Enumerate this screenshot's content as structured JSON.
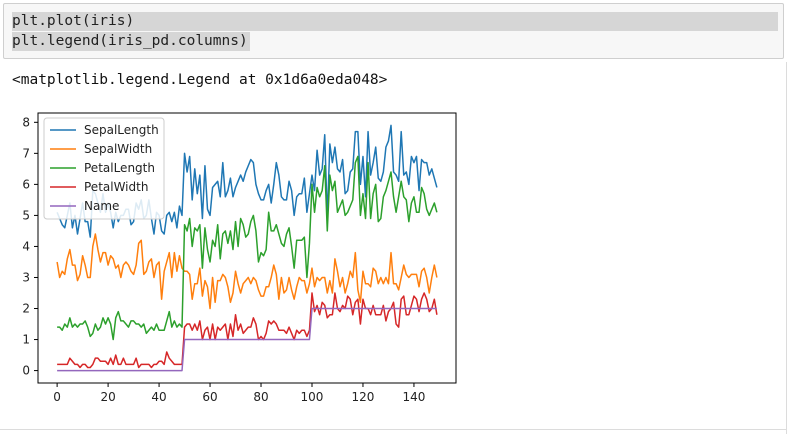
{
  "code_cell": {
    "lines": [
      "plt.plot(iris)",
      "plt.legend(iris_pd.columns)"
    ]
  },
  "output": {
    "text": "<matplotlib.legend.Legend at 0x1d6a0eda048>"
  },
  "chart_data": {
    "type": "line",
    "x_ticks": [
      0,
      20,
      40,
      60,
      80,
      100,
      120,
      140
    ],
    "y_ticks": [
      0,
      1,
      2,
      3,
      4,
      5,
      6,
      7,
      8
    ],
    "xlim": [
      -7.5,
      156.5
    ],
    "ylim": [
      -0.4,
      8.3
    ],
    "legend_position": "upper-left",
    "grid": false,
    "series": [
      {
        "name": "SepalLength",
        "color": "#1f77b4",
        "values": [
          5.1,
          4.9,
          4.7,
          4.6,
          5.0,
          5.4,
          4.6,
          5.0,
          4.4,
          4.9,
          5.4,
          4.8,
          4.8,
          4.3,
          5.8,
          5.7,
          5.4,
          5.1,
          5.7,
          5.1,
          5.4,
          5.1,
          4.6,
          5.1,
          4.8,
          5.0,
          5.0,
          5.2,
          5.2,
          4.7,
          4.8,
          5.4,
          5.2,
          5.5,
          4.9,
          5.0,
          5.5,
          4.9,
          4.4,
          5.1,
          5.0,
          4.5,
          4.4,
          5.0,
          5.1,
          4.8,
          5.1,
          4.6,
          5.3,
          5.0,
          7.0,
          6.4,
          6.9,
          5.5,
          6.5,
          5.7,
          6.3,
          4.9,
          6.6,
          5.2,
          5.0,
          5.9,
          6.0,
          6.1,
          5.6,
          6.7,
          5.6,
          5.8,
          6.2,
          5.6,
          5.9,
          6.1,
          6.3,
          6.1,
          6.4,
          6.6,
          6.8,
          6.7,
          6.0,
          5.7,
          5.5,
          5.5,
          5.8,
          6.0,
          5.4,
          6.0,
          6.7,
          6.3,
          5.6,
          5.5,
          5.5,
          6.1,
          5.8,
          5.0,
          5.6,
          5.7,
          5.7,
          6.2,
          5.1,
          5.7,
          6.3,
          5.8,
          7.1,
          6.3,
          6.5,
          7.6,
          4.9,
          7.3,
          6.7,
          7.2,
          6.5,
          6.4,
          6.8,
          5.7,
          5.8,
          6.4,
          6.5,
          7.7,
          7.7,
          6.0,
          6.9,
          5.6,
          7.7,
          6.3,
          6.7,
          7.2,
          6.2,
          6.1,
          6.4,
          7.2,
          7.4,
          7.9,
          6.4,
          6.3,
          6.1,
          7.7,
          6.3,
          6.4,
          6.0,
          6.9,
          6.7,
          6.9,
          5.8,
          6.8,
          6.7,
          6.7,
          6.3,
          6.5,
          6.2,
          5.9
        ]
      },
      {
        "name": "SepalWidth",
        "color": "#ff7f0e",
        "values": [
          3.5,
          3.0,
          3.2,
          3.1,
          3.6,
          3.9,
          3.4,
          3.4,
          2.9,
          3.1,
          3.7,
          3.4,
          3.0,
          3.0,
          4.0,
          4.4,
          3.9,
          3.5,
          3.8,
          3.8,
          3.4,
          3.7,
          3.6,
          3.3,
          3.4,
          3.0,
          3.4,
          3.5,
          3.4,
          3.2,
          3.1,
          3.4,
          4.1,
          4.2,
          3.1,
          3.2,
          3.5,
          3.6,
          3.0,
          3.4,
          3.5,
          2.3,
          3.2,
          3.5,
          3.8,
          3.0,
          3.8,
          3.2,
          3.7,
          3.3,
          3.2,
          3.2,
          3.1,
          2.3,
          2.8,
          2.8,
          3.3,
          2.4,
          2.9,
          2.7,
          2.0,
          3.0,
          2.2,
          2.9,
          2.9,
          3.1,
          3.0,
          2.7,
          2.2,
          2.5,
          3.2,
          2.8,
          2.5,
          2.8,
          2.9,
          3.0,
          2.8,
          3.0,
          2.9,
          2.6,
          2.4,
          2.4,
          2.7,
          2.7,
          3.0,
          3.4,
          3.1,
          2.3,
          3.0,
          2.5,
          2.6,
          3.0,
          2.6,
          2.3,
          2.7,
          3.0,
          2.9,
          2.9,
          2.5,
          2.8,
          3.3,
          2.7,
          3.0,
          2.9,
          3.0,
          3.0,
          2.5,
          2.9,
          2.5,
          3.6,
          3.2,
          2.7,
          3.0,
          2.5,
          2.8,
          3.2,
          3.0,
          3.8,
          2.6,
          2.2,
          3.2,
          2.8,
          2.8,
          2.7,
          3.3,
          3.2,
          2.8,
          3.0,
          2.8,
          3.0,
          2.8,
          3.8,
          2.8,
          2.8,
          2.6,
          3.0,
          3.4,
          3.1,
          3.0,
          3.1,
          3.1,
          3.1,
          2.7,
          3.2,
          3.3,
          3.0,
          2.5,
          3.0,
          3.4,
          3.0
        ]
      },
      {
        "name": "PetalLength",
        "color": "#2ca02c",
        "values": [
          1.4,
          1.4,
          1.3,
          1.5,
          1.4,
          1.7,
          1.4,
          1.5,
          1.4,
          1.5,
          1.5,
          1.6,
          1.4,
          1.1,
          1.2,
          1.5,
          1.3,
          1.4,
          1.7,
          1.5,
          1.7,
          1.5,
          1.0,
          1.7,
          1.9,
          1.6,
          1.6,
          1.5,
          1.4,
          1.6,
          1.6,
          1.5,
          1.5,
          1.4,
          1.5,
          1.2,
          1.3,
          1.4,
          1.3,
          1.5,
          1.3,
          1.3,
          1.3,
          1.6,
          1.9,
          1.4,
          1.6,
          1.4,
          1.5,
          1.4,
          4.7,
          4.5,
          4.9,
          4.0,
          4.6,
          4.5,
          4.7,
          3.3,
          4.6,
          3.9,
          3.5,
          4.2,
          4.0,
          4.7,
          3.6,
          4.4,
          4.5,
          4.1,
          4.5,
          3.9,
          4.8,
          4.0,
          4.9,
          4.7,
          4.3,
          4.4,
          4.8,
          5.0,
          4.5,
          3.5,
          3.8,
          3.7,
          3.9,
          5.1,
          4.5,
          4.5,
          4.7,
          4.4,
          4.1,
          4.0,
          4.4,
          4.6,
          4.0,
          3.3,
          4.2,
          4.2,
          4.2,
          4.3,
          3.0,
          4.1,
          6.0,
          5.1,
          5.9,
          5.6,
          5.8,
          6.6,
          4.5,
          6.3,
          5.8,
          6.1,
          5.1,
          5.3,
          5.5,
          5.0,
          5.1,
          5.3,
          5.5,
          6.7,
          6.9,
          5.0,
          5.7,
          4.9,
          6.7,
          4.9,
          5.7,
          6.0,
          4.8,
          4.9,
          5.6,
          5.8,
          6.1,
          6.4,
          5.6,
          5.1,
          5.6,
          6.1,
          5.6,
          5.5,
          4.8,
          5.4,
          5.6,
          5.1,
          5.1,
          5.9,
          5.7,
          5.2,
          5.0,
          5.2,
          5.4,
          5.1
        ]
      },
      {
        "name": "PetalWidth",
        "color": "#d62728",
        "values": [
          0.2,
          0.2,
          0.2,
          0.2,
          0.2,
          0.4,
          0.3,
          0.2,
          0.2,
          0.1,
          0.2,
          0.2,
          0.1,
          0.1,
          0.2,
          0.4,
          0.4,
          0.3,
          0.3,
          0.3,
          0.2,
          0.4,
          0.2,
          0.5,
          0.2,
          0.2,
          0.4,
          0.2,
          0.2,
          0.2,
          0.2,
          0.4,
          0.1,
          0.2,
          0.2,
          0.2,
          0.2,
          0.1,
          0.2,
          0.2,
          0.3,
          0.3,
          0.2,
          0.6,
          0.4,
          0.3,
          0.2,
          0.2,
          0.2,
          0.2,
          1.4,
          1.5,
          1.5,
          1.3,
          1.5,
          1.3,
          1.6,
          1.0,
          1.3,
          1.4,
          1.0,
          1.5,
          1.0,
          1.4,
          1.3,
          1.4,
          1.5,
          1.0,
          1.5,
          1.1,
          1.8,
          1.3,
          1.5,
          1.2,
          1.3,
          1.4,
          1.4,
          1.7,
          1.5,
          1.0,
          1.1,
          1.0,
          1.2,
          1.6,
          1.5,
          1.6,
          1.5,
          1.3,
          1.3,
          1.3,
          1.2,
          1.4,
          1.2,
          1.0,
          1.3,
          1.2,
          1.3,
          1.3,
          1.1,
          1.3,
          2.5,
          1.9,
          2.1,
          1.8,
          2.2,
          2.1,
          1.7,
          1.8,
          1.8,
          2.5,
          2.0,
          1.9,
          2.1,
          2.0,
          2.4,
          2.3,
          1.8,
          2.2,
          2.3,
          1.5,
          2.3,
          2.0,
          2.0,
          1.8,
          2.1,
          1.8,
          1.8,
          1.8,
          2.1,
          1.6,
          1.9,
          2.0,
          2.2,
          1.5,
          1.4,
          2.3,
          2.4,
          1.8,
          1.8,
          2.1,
          2.4,
          2.3,
          1.9,
          2.3,
          2.5,
          2.3,
          1.9,
          2.0,
          2.3,
          1.8
        ]
      },
      {
        "name": "Name",
        "color": "#9467bd",
        "values_description": "class index",
        "values": [
          0,
          0,
          0,
          0,
          0,
          0,
          0,
          0,
          0,
          0,
          0,
          0,
          0,
          0,
          0,
          0,
          0,
          0,
          0,
          0,
          0,
          0,
          0,
          0,
          0,
          0,
          0,
          0,
          0,
          0,
          0,
          0,
          0,
          0,
          0,
          0,
          0,
          0,
          0,
          0,
          0,
          0,
          0,
          0,
          0,
          0,
          0,
          0,
          0,
          0,
          1,
          1,
          1,
          1,
          1,
          1,
          1,
          1,
          1,
          1,
          1,
          1,
          1,
          1,
          1,
          1,
          1,
          1,
          1,
          1,
          1,
          1,
          1,
          1,
          1,
          1,
          1,
          1,
          1,
          1,
          1,
          1,
          1,
          1,
          1,
          1,
          1,
          1,
          1,
          1,
          1,
          1,
          1,
          1,
          1,
          1,
          1,
          1,
          1,
          1,
          2,
          2,
          2,
          2,
          2,
          2,
          2,
          2,
          2,
          2,
          2,
          2,
          2,
          2,
          2,
          2,
          2,
          2,
          2,
          2,
          2,
          2,
          2,
          2,
          2,
          2,
          2,
          2,
          2,
          2,
          2,
          2,
          2,
          2,
          2,
          2,
          2,
          2,
          2,
          2,
          2,
          2,
          2,
          2,
          2,
          2,
          2,
          2,
          2,
          2
        ]
      }
    ]
  }
}
